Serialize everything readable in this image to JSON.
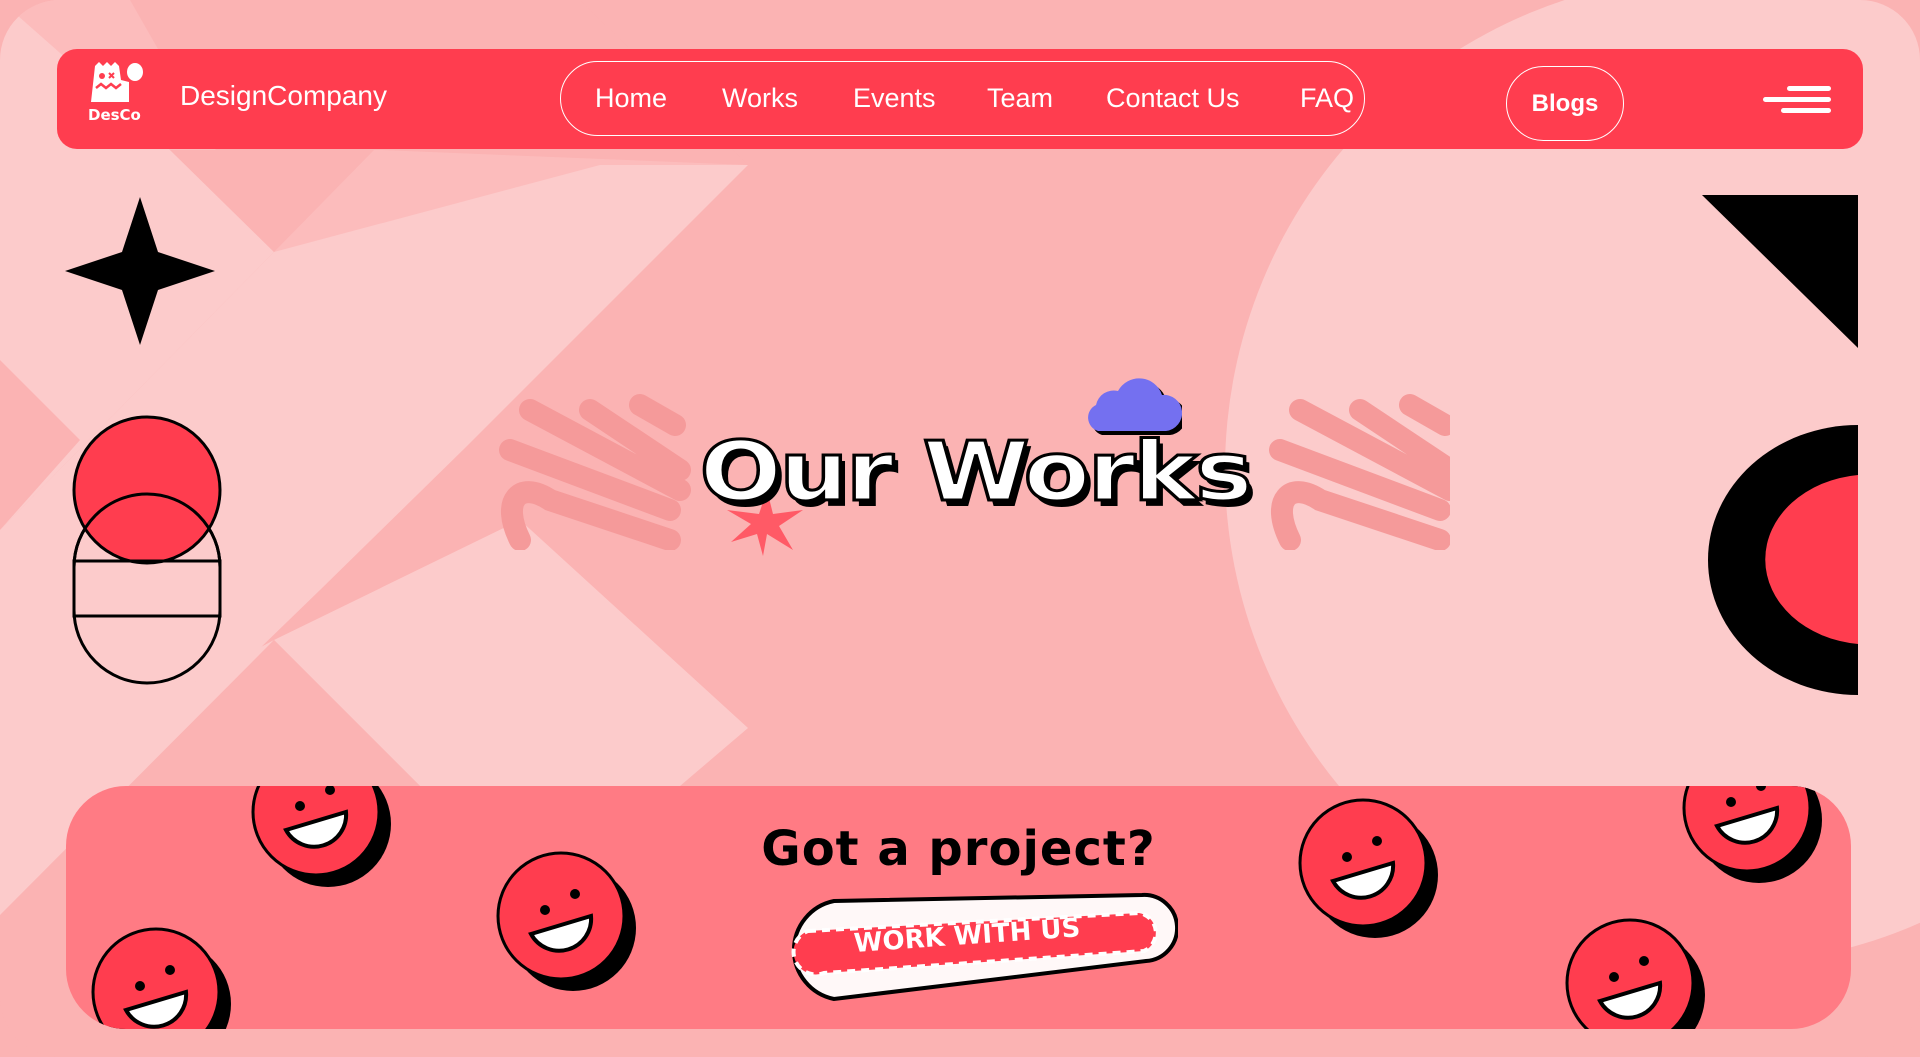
{
  "brand": {
    "logo_text": "DesCo",
    "name": "DesignCompany"
  },
  "nav": {
    "items": [
      "Home",
      "Works",
      "Events",
      "Team",
      "Contact Us",
      "FAQ"
    ],
    "blogs": "Blogs"
  },
  "hero": {
    "title": "Our Works"
  },
  "cta": {
    "heading": "Got a project?",
    "button": "WORK WITH US"
  },
  "colors": {
    "accent": "#ff3d4f",
    "panel": "#ff7b84",
    "bg": "#fbb3b3",
    "bg_light": "#fccbcb",
    "cloud": "#7470f0"
  }
}
